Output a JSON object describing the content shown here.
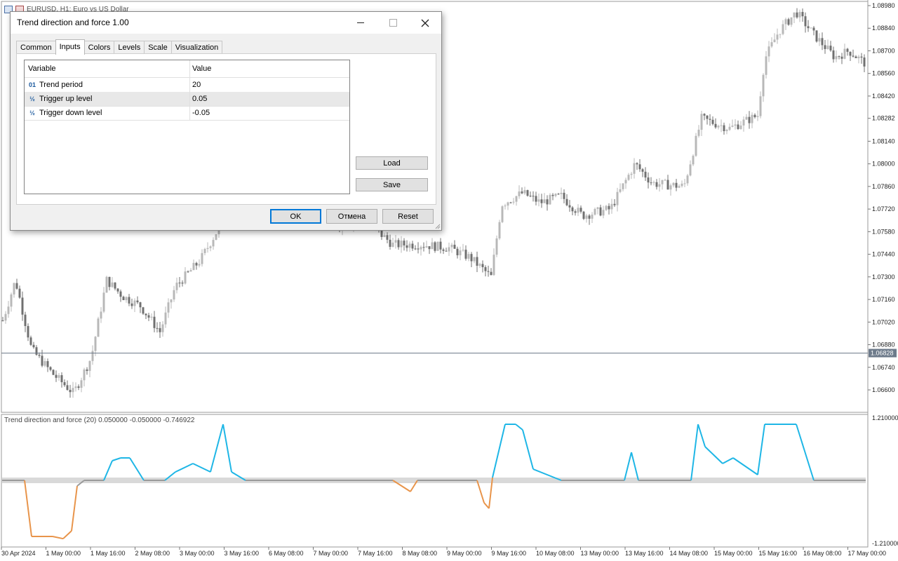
{
  "chart": {
    "symbol_line": "EURUSD, H1: Euro vs US Dollar",
    "current_price": "1.06828",
    "price_ticks": [
      "1.08980",
      "1.08840",
      "1.08700",
      "1.08560",
      "1.08420",
      "1.08282",
      "1.08140",
      "1.08000",
      "1.07860",
      "1.07720",
      "1.07580",
      "1.07440",
      "1.07300",
      "1.07160",
      "1.07020",
      "1.06880",
      "1.06740",
      "1.06600"
    ],
    "time_ticks": [
      "30 Apr 2024",
      "1 May 00:00",
      "1 May 16:00",
      "2 May 08:00",
      "3 May 00:00",
      "3 May 16:00",
      "6 May 08:00",
      "7 May 00:00",
      "7 May 16:00",
      "8 May 08:00",
      "9 May 00:00",
      "9 May 16:00",
      "10 May 08:00",
      "13 May 00:00",
      "13 May 16:00",
      "14 May 08:00",
      "15 May 00:00",
      "15 May 16:00",
      "16 May 08:00",
      "17 May 00:00"
    ],
    "indicator_label": "Trend direction and force (20) 0.050000 -0.050000 -0.746922",
    "indicator_max": "1.210000",
    "indicator_min": "-1.210000",
    "colors": {
      "up": "#1eb6e6",
      "down": "#e8944a",
      "neutral": "#9a9a9a",
      "band": "#d9d9d9",
      "candle": "#8c8c8c"
    }
  },
  "dialog": {
    "title": "Trend direction and force 1.00",
    "tabs": [
      "Common",
      "Inputs",
      "Colors",
      "Levels",
      "Scale",
      "Visualization"
    ],
    "active_tab": "Inputs",
    "grid_headers": {
      "variable": "Variable",
      "value": "Value"
    },
    "rows": [
      {
        "icon": "01",
        "name": "Trend period",
        "value": "20"
      },
      {
        "icon": "½",
        "name": "Trigger up level",
        "value": "0.05"
      },
      {
        "icon": "½",
        "name": "Trigger down level",
        "value": "-0.05"
      }
    ],
    "buttons": {
      "load": "Load",
      "save": "Save",
      "ok": "OK",
      "cancel": "Отмена",
      "reset": "Reset"
    }
  }
}
